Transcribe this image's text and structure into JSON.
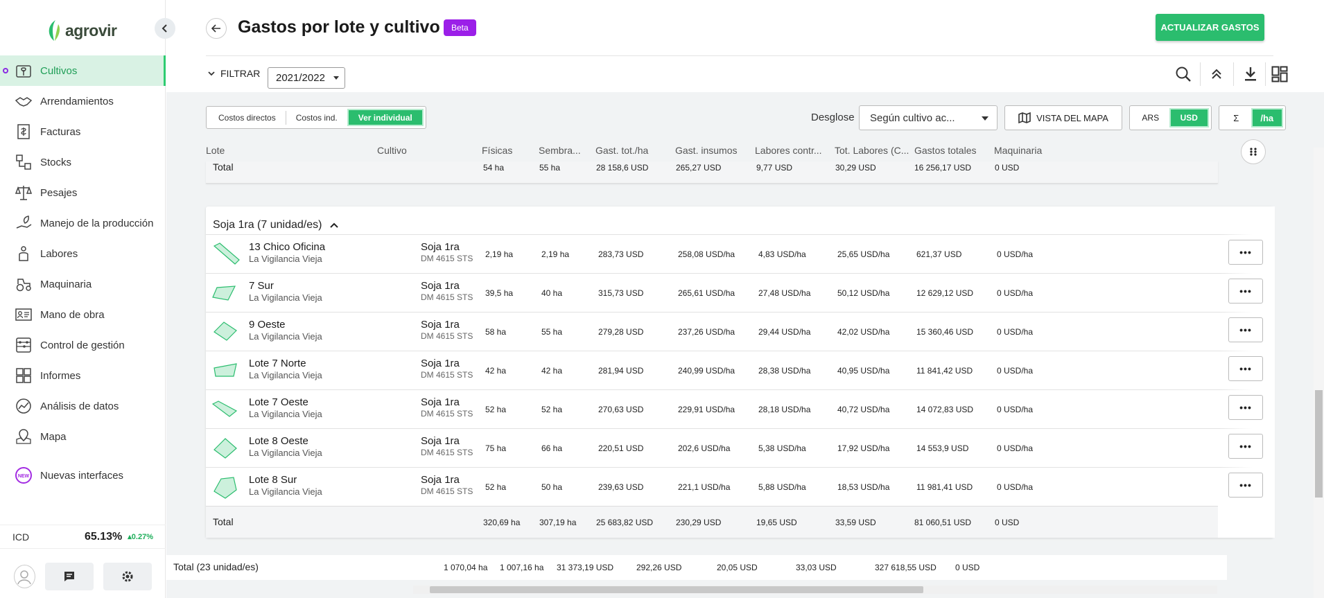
{
  "app": {
    "logo_text": "agrovir"
  },
  "sidebar": {
    "items": [
      {
        "label": "Cultivos",
        "icon": "crop-icon",
        "active": true
      },
      {
        "label": "Arrendamientos",
        "icon": "handshake-icon"
      },
      {
        "label": "Facturas",
        "icon": "invoice-icon"
      },
      {
        "label": "Stocks",
        "icon": "stocks-icon"
      },
      {
        "label": "Pesajes",
        "icon": "scale-icon"
      },
      {
        "label": "Manejo de la producción",
        "icon": "production-icon"
      },
      {
        "label": "Labores",
        "icon": "labor-icon"
      },
      {
        "label": "Maquinaria",
        "icon": "tractor-icon"
      },
      {
        "label": "Mano de obra",
        "icon": "worker-id-icon"
      },
      {
        "label": "Control de gestión",
        "icon": "abacus-icon"
      },
      {
        "label": "Informes",
        "icon": "reports-icon"
      },
      {
        "label": "Análisis de datos",
        "icon": "analytics-icon"
      },
      {
        "label": "Mapa",
        "icon": "map-icon"
      },
      {
        "label": "Nuevas interfaces",
        "icon": "new-badge-icon"
      }
    ],
    "icd": {
      "label": "ICD",
      "value": "65.13%",
      "delta": "0.27%"
    },
    "new_badge": "NEW"
  },
  "header": {
    "title": "Gastos por lote y cultivo",
    "badge": "Beta",
    "update_button": "ACTUALIZAR GASTOS",
    "filter_label": "FILTRAR",
    "season": "2021/2022"
  },
  "toolbar": {
    "segments": [
      "Costos directos",
      "Costos ind.",
      "Ver individual"
    ],
    "desglose_label": "Desglose",
    "desglose_value": "Según cultivo ac...",
    "map_button": "VISTA DEL MAPA",
    "currency": [
      "ARS",
      "USD"
    ],
    "unit": [
      "Σ",
      "/ha"
    ],
    "accent": "#2bbd6e"
  },
  "table": {
    "columns": [
      "Lote",
      "Cultivo",
      "Físicas",
      "Sembra...",
      "Gast. tot./ha",
      "Gast. insumos",
      "Labores contr...",
      "Tot. Labores (C...",
      "Gastos totales",
      "Maquinaria"
    ],
    "prev_total": {
      "label": "Total",
      "cells": [
        "54 ha",
        "55 ha",
        "28 158,6 USD",
        "265,27 USD",
        "9,77 USD",
        "30,29 USD",
        "16 256,17 USD",
        "0 USD"
      ]
    },
    "group": {
      "title": "Soja 1ra (7 unidad/es)",
      "rows": [
        {
          "lote": "13 Chico Oficina",
          "campo": "La Vigilancia Vieja",
          "cultivo": "Soja 1ra",
          "variedad": "DM 4615 STS",
          "cells": [
            "2,19 ha",
            "2,19 ha",
            "283,73 USD",
            "258,08 USD/ha",
            "4,83 USD/ha",
            "25,65 USD/ha",
            "621,37 USD",
            "0 USD/ha"
          ]
        },
        {
          "lote": "7 Sur",
          "campo": "La Vigilancia Vieja",
          "cultivo": "Soja 1ra",
          "variedad": "DM 4615 STS",
          "cells": [
            "39,5 ha",
            "40 ha",
            "315,73 USD",
            "265,61 USD/ha",
            "27,48 USD/ha",
            "50,12 USD/ha",
            "12 629,12 USD",
            "0 USD/ha"
          ]
        },
        {
          "lote": "9 Oeste",
          "campo": "La Vigilancia Vieja",
          "cultivo": "Soja 1ra",
          "variedad": "DM 4615 STS",
          "cells": [
            "58 ha",
            "55 ha",
            "279,28 USD",
            "237,26 USD/ha",
            "29,44 USD/ha",
            "42,02 USD/ha",
            "15 360,46 USD",
            "0 USD/ha"
          ]
        },
        {
          "lote": "Lote 7 Norte",
          "campo": "La Vigilancia Vieja",
          "cultivo": "Soja 1ra",
          "variedad": "DM 4615 STS",
          "cells": [
            "42 ha",
            "42 ha",
            "281,94 USD",
            "240,99 USD/ha",
            "28,38 USD/ha",
            "40,95 USD/ha",
            "11 841,42 USD",
            "0 USD/ha"
          ]
        },
        {
          "lote": "Lote 7 Oeste",
          "campo": "La Vigilancia Vieja",
          "cultivo": "Soja 1ra",
          "variedad": "DM 4615 STS",
          "cells": [
            "52 ha",
            "52 ha",
            "270,63 USD",
            "229,91 USD/ha",
            "28,18 USD/ha",
            "40,72 USD/ha",
            "14 072,83 USD",
            "0 USD/ha"
          ]
        },
        {
          "lote": "Lote 8 Oeste",
          "campo": "La Vigilancia Vieja",
          "cultivo": "Soja 1ra",
          "variedad": "DM 4615 STS",
          "cells": [
            "75 ha",
            "66 ha",
            "220,51 USD",
            "202,6 USD/ha",
            "5,38 USD/ha",
            "17,92 USD/ha",
            "14 553,9 USD",
            "0 USD/ha"
          ]
        },
        {
          "lote": "Lote 8 Sur",
          "campo": "La Vigilancia Vieja",
          "cultivo": "Soja 1ra",
          "variedad": "DM 4615 STS",
          "cells": [
            "52 ha",
            "50 ha",
            "239,63 USD",
            "221,1 USD/ha",
            "5,88 USD/ha",
            "18,53 USD/ha",
            "11 981,41 USD",
            "0 USD/ha"
          ]
        }
      ],
      "total": {
        "label": "Total",
        "cells": [
          "320,69 ha",
          "307,19 ha",
          "25 683,82 USD",
          "230,29 USD",
          "19,65 USD",
          "33,59 USD",
          "81 060,51 USD",
          "0 USD"
        ]
      }
    },
    "grand_total": {
      "label": "Total (23 unidad/es)",
      "cells": [
        "1 070,04 ha",
        "1 007,16 ha",
        "31 373,19 USD",
        "292,26 USD",
        "20,05 USD",
        "33,03 USD",
        "327 618,55 USD",
        "0 USD"
      ]
    },
    "more_label": "•••"
  }
}
